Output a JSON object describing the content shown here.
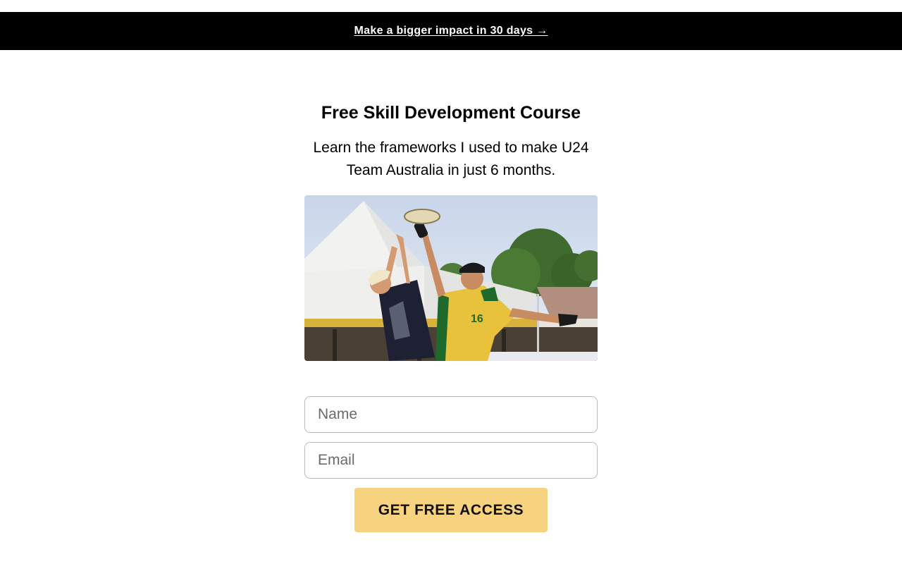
{
  "announcement": {
    "link_text": "Make a bigger impact in 30 days →"
  },
  "hero": {
    "title": "Free Skill Development Course",
    "subtitle": "Learn the frameworks I used to make U24 Team Australia in just 6 months.",
    "jersey_number": "16"
  },
  "form": {
    "name_placeholder": "Name",
    "email_placeholder": "Email",
    "submit_label": "GET FREE ACCESS"
  },
  "colors": {
    "banner_bg": "#000000",
    "cta_bg": "#f7d27f",
    "jersey_yellow": "#e8c23a",
    "jersey_green": "#1f6a2a"
  }
}
